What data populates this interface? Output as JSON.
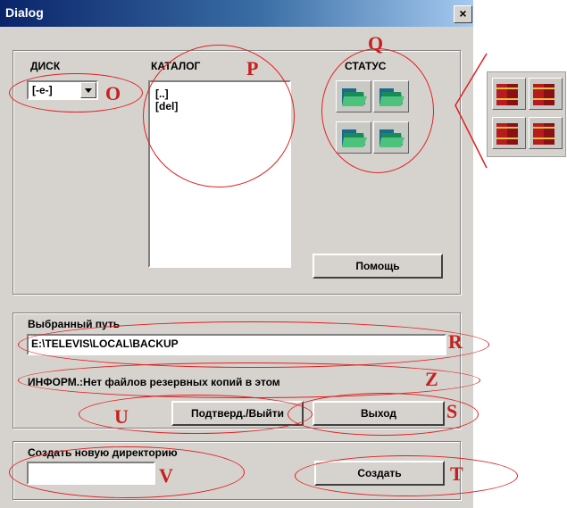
{
  "window": {
    "title": "Dialog",
    "close": "×"
  },
  "disk": {
    "label": "ДИСК",
    "value": "[-e-]"
  },
  "catalog": {
    "label": "КАТАЛОГ",
    "items": [
      "[..]",
      "[del]"
    ]
  },
  "status": {
    "label": "СТАТУС"
  },
  "help_button": "Помощь",
  "selected_path": {
    "label": "Выбранный путь",
    "value": "E:\\TELEVIS\\LOCAL\\BACKUP"
  },
  "info": "ИНФОРМ.:Нет файлов резервных копий в этом",
  "confirm_button": "Подтверд./Выйти",
  "exit_button": "Выход",
  "new_dir": {
    "label": "Создать новую директорию",
    "value": ""
  },
  "create_button": "Создать",
  "annotations": {
    "O": "O",
    "P": "P",
    "Q": "Q",
    "R": "R",
    "Z": "Z",
    "U": "U",
    "S": "S",
    "V": "V",
    "T": "T"
  },
  "colors": {
    "annotation": "#e02020",
    "title_bar": "#0a246a",
    "window": "#d6d3ce",
    "book_red": "#b81a22",
    "folder_green": "#1a8a5a"
  },
  "icons": {
    "status": "green-folder-icon",
    "zoom": "red-books-icon"
  }
}
